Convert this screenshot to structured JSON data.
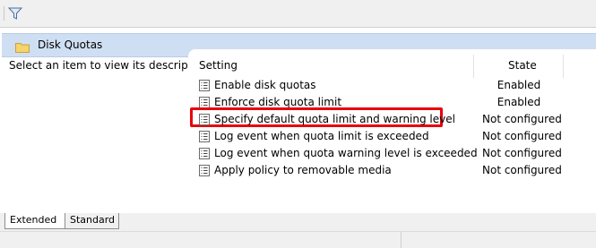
{
  "header": {
    "title": "Disk Quotas"
  },
  "description": {
    "text": "Select an item to view its description."
  },
  "columns": {
    "setting": "Setting",
    "state": "State"
  },
  "rows": [
    {
      "name": "Enable disk quotas",
      "state": "Enabled"
    },
    {
      "name": "Enforce disk quota limit",
      "state": "Enabled"
    },
    {
      "name": "Specify default quota limit and warning level",
      "state": "Not configured",
      "highlighted": true
    },
    {
      "name": "Log event when quota limit is exceeded",
      "state": "Not configured"
    },
    {
      "name": "Log event when quota warning level is exceeded",
      "state": "Not configured"
    },
    {
      "name": "Apply policy to removable media",
      "state": "Not configured"
    }
  ],
  "tabs": [
    {
      "label": "Extended"
    },
    {
      "label": "Standard"
    }
  ],
  "colors": {
    "header_band": "#cfdff3",
    "highlight": "#e8000b"
  }
}
